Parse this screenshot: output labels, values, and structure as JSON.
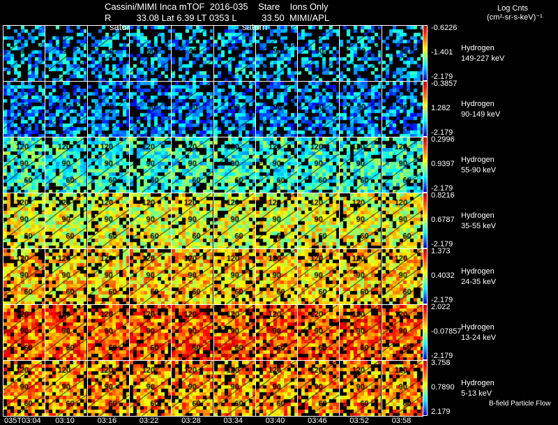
{
  "header": {
    "title": "Cassini/MIMI Inca mTOF  2016-035    Stare    Ions Only",
    "subtitle": "R          33.08 Lat 6.39 LT 0353 L          33.50  MIMI/APL",
    "markers": [
      "satur",
      "saturn"
    ]
  },
  "units": {
    "line1": "Log Cnts",
    "line2": "(cm²-sr-s-keV)⁻¹"
  },
  "chart_data": {
    "type": "heatmap",
    "title": "Cassini/MIMI Inca mTOF  2016-035    Stare    Ions Only",
    "x_tick_labels": [
      "035T03:04",
      "03:10",
      "03:16",
      "03:22",
      "03:28",
      "03:34",
      "03:40",
      "03:46",
      "03:52",
      "03:58"
    ],
    "contour_labels": [
      "150",
      "120",
      "90",
      "60"
    ],
    "colormap": "jet",
    "rows": [
      {
        "species": "Hydrogen",
        "energy": "149-227 keV",
        "cmax": "-0.6226",
        "cmid": "-1.401",
        "cmin": "-2.179",
        "level": 0.3,
        "coverage": 0.55
      },
      {
        "species": "Hydrogen",
        "energy": "90-149 keV",
        "cmax": "-0.3857",
        "cmid": "1.282",
        "cmin": "-2.179",
        "level": 0.27,
        "coverage": 0.7
      },
      {
        "species": "Hydrogen",
        "energy": "55-90 keV",
        "cmax": "0.2996",
        "cmid": "0.9397",
        "cmin": "-2.179",
        "level": 0.42,
        "coverage": 0.85
      },
      {
        "species": "Hydrogen",
        "energy": "35-55 keV",
        "cmax": "0.8216",
        "cmid": "0.6787",
        "cmin": "-2.179",
        "level": 0.6,
        "coverage": 0.9
      },
      {
        "species": "Hydrogen",
        "energy": "24-35 keV",
        "cmax": "1.373",
        "cmid": "0.4032",
        "cmin": "-2.179",
        "level": 0.67,
        "coverage": 0.9
      },
      {
        "species": "Hydrogen",
        "energy": "13-24 keV",
        "cmax": "2.022",
        "cmid": "-0.07857",
        "cmin": "-2.179",
        "level": 0.78,
        "coverage": 0.92
      },
      {
        "species": "Hydrogen",
        "energy": "5-13 keV",
        "cmax": "3.758",
        "cmid": "0.7890",
        "cmin": "2.179",
        "level": 0.72,
        "coverage": 0.85
      }
    ]
  },
  "footer": {
    "legend": "B-field Particle Flow"
  }
}
